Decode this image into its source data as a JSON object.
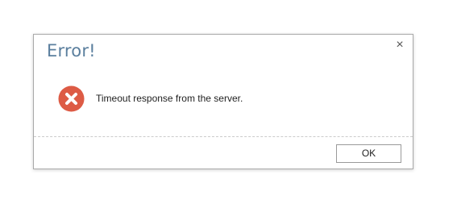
{
  "dialog": {
    "title": "Error!",
    "close_label": "×",
    "message": "Timeout response from the server.",
    "ok_label": "OK",
    "icon": "error-x-circle-icon"
  },
  "colors": {
    "title": "#5b7f9e",
    "error_icon": "#dd5b45",
    "border": "#a9a9a9"
  }
}
